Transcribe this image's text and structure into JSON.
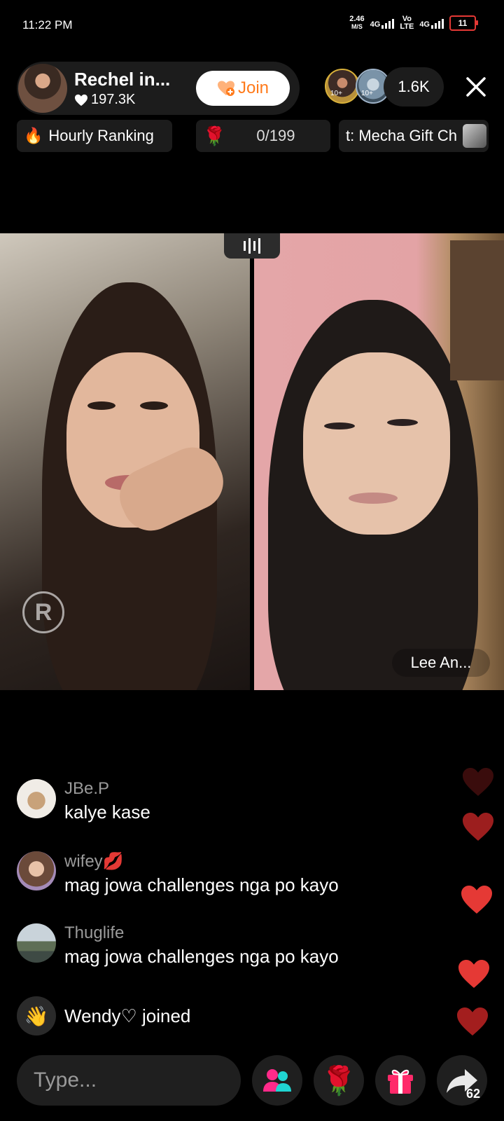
{
  "status_bar": {
    "time": "11:22 PM",
    "net_speed": "2.46",
    "net_unit": "M/S",
    "net1": "4G",
    "volte1": "Vo",
    "volte2": "LTE",
    "net2": "4G",
    "battery": "11"
  },
  "host": {
    "name": "Rechel in...",
    "likes": "197.3K",
    "join_label": "Join"
  },
  "viewers": {
    "badge1": "10+",
    "badge2": "10+",
    "count": "1.6K"
  },
  "chips": {
    "ranking_label": "Hourly Ranking",
    "rose_goal": "0/199",
    "gift_label": "t: Mecha Gift Ch"
  },
  "video": {
    "watermark": "R",
    "guest_name": "Lee An..."
  },
  "chat": [
    {
      "user": "JBe.P",
      "message": "kalye kase"
    },
    {
      "user": "wifey💋",
      "message": "mag jowa challenges nga po kayo"
    },
    {
      "user": "Thuglife",
      "message": "mag jowa challenges nga po kayo"
    }
  ],
  "joined": {
    "user": "Wendy♡",
    "action": "joined"
  },
  "bottom": {
    "placeholder": "Type...",
    "share_count": "62"
  },
  "colors": {
    "accent": "#ff7a1a",
    "heart": "#e53935",
    "dark_heart": "#8b1a1a"
  }
}
